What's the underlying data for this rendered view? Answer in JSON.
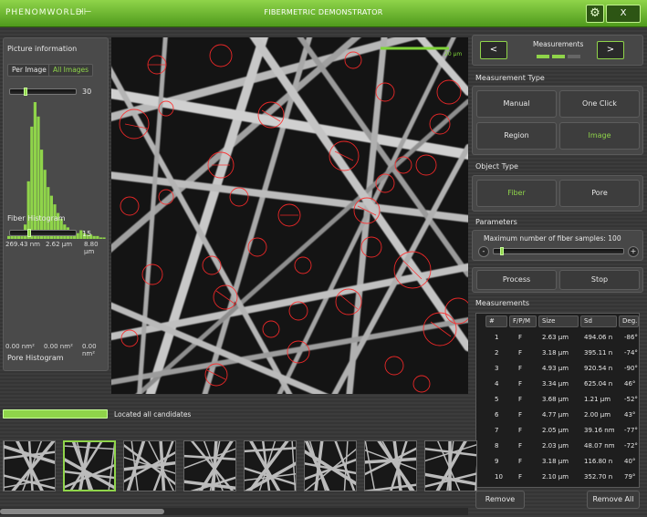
{
  "titlebar": {
    "logo": "PHENOMWORLD",
    "logo_icon": "fiber-logo-icon",
    "title": "FIBERMETRIC DEMONSTRATOR",
    "settings_icon": "gears-icon",
    "close_label": "X"
  },
  "left_panel": {
    "picture_info_title": "Picture information",
    "per_image_label": "Per Image",
    "all_images_label": "All Images",
    "bins_slider_value": "30",
    "bins_slider_fraction": 0.22,
    "hist_min": "269.43 nm",
    "hist_mid": "2.62 μm",
    "hist_max": "8.80 μm",
    "fiber_hist_label": "Fiber Histogram",
    "fiber_slider_value": "15",
    "fiber_slider_fraction": 0.27,
    "pore_min": "0.00 nm²",
    "pore_mid": "0.00 nm²",
    "pore_max": "0.00 nm²",
    "pore_hist_label": "Pore Histogram",
    "histogram_values": [
      2,
      3,
      3,
      4,
      6,
      10,
      40,
      78,
      95,
      85,
      62,
      48,
      36,
      30,
      24,
      18,
      14,
      10,
      8,
      6,
      5,
      4,
      6,
      4,
      3,
      3,
      2,
      2,
      1,
      1
    ]
  },
  "image": {
    "scale_label": "20 μm"
  },
  "right_panel": {
    "prev_label": "<",
    "next_label": ">",
    "measurements_title": "Measurements",
    "measurement_type_title": "Measurement Type",
    "manual_label": "Manual",
    "one_click_label": "One Click",
    "region_label": "Region",
    "image_label": "Image",
    "object_type_title": "Object Type",
    "fiber_label": "Fiber",
    "pore_label": "Pore",
    "parameters_title": "Parameters",
    "max_samples_label": "Maximum number of fiber samples:",
    "max_samples_value": "100",
    "samples_slider_fraction": 0.05,
    "minus_label": "-",
    "plus_label": "+",
    "process_label": "Process",
    "stop_label": "Stop",
    "measurements_list_title": "Measurements",
    "remove_label": "Remove",
    "remove_all_label": "Remove All",
    "columns": [
      "#",
      "F/P/M",
      "Size",
      "Sd",
      "Deg."
    ],
    "rows": [
      [
        "1",
        "F",
        "2.63 μm",
        "494.06 n",
        "-86°"
      ],
      [
        "2",
        "F",
        "3.18 μm",
        "395.11 n",
        "-74°"
      ],
      [
        "3",
        "F",
        "4.93 μm",
        "920.54 n",
        "-90°"
      ],
      [
        "4",
        "F",
        "3.34 μm",
        "625.04 n",
        "46°"
      ],
      [
        "5",
        "F",
        "3.68 μm",
        "1.21 μm",
        "-52°"
      ],
      [
        "6",
        "F",
        "4.77 μm",
        "2.00 μm",
        "43°"
      ],
      [
        "7",
        "F",
        "2.05 μm",
        "39.16 nm",
        "-77°"
      ],
      [
        "8",
        "F",
        "2.03 μm",
        "48.07 nm",
        "-72°"
      ],
      [
        "9",
        "F",
        "3.18 μm",
        "116.80 n",
        "40°"
      ],
      [
        "10",
        "F",
        "2.10 μm",
        "352.70 n",
        "79°"
      ]
    ]
  },
  "status": {
    "progress_fraction": 1.0,
    "progress_text": "Located all candidates"
  }
}
